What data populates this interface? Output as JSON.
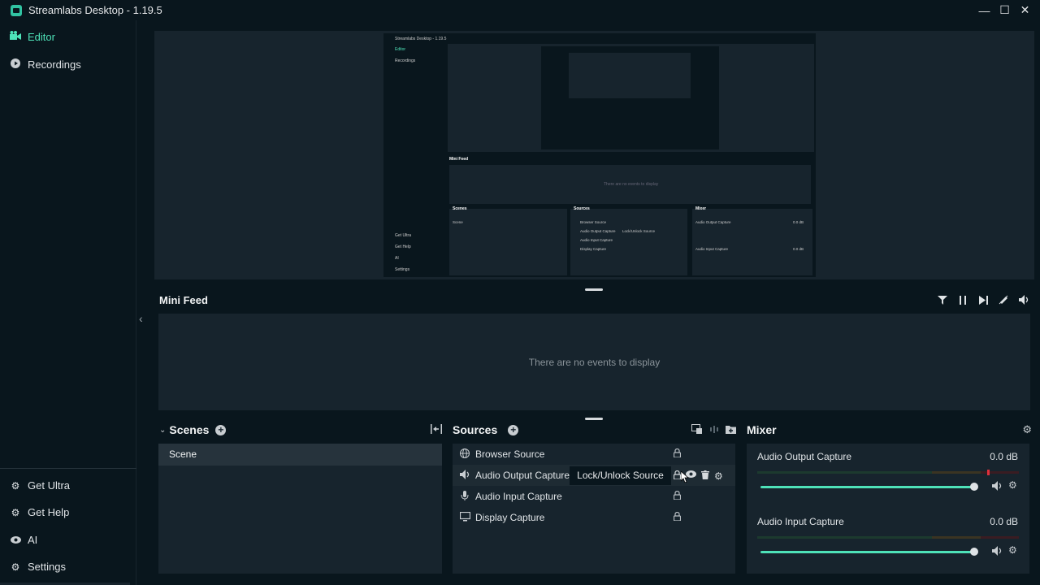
{
  "window": {
    "title": "Streamlabs Desktop - 1.19.5",
    "minimize": "—",
    "maximize": "☐",
    "close": "✕"
  },
  "nav": {
    "items": [
      {
        "label": "Editor",
        "icon": "editor-icon"
      },
      {
        "label": "Recordings",
        "icon": "recordings-icon"
      }
    ],
    "bottom": [
      {
        "label": "Get Ultra",
        "icon": "ultra-icon"
      },
      {
        "label": "Get Help",
        "icon": "help-icon"
      },
      {
        "label": "AI",
        "icon": "ai-eye-icon"
      },
      {
        "label": "Settings",
        "icon": "gear-icon"
      }
    ]
  },
  "nested": {
    "title": "Streamlabs Desktop - 1.19.5",
    "nav": [
      "Editor",
      "Recordings"
    ],
    "nav_bottom": [
      "Get Ultra",
      "Get Help",
      "AI",
      "Settings"
    ],
    "mini_feed": "Mini Feed",
    "empty": "There are no events to display",
    "scenes": "Scenes",
    "scene": "Scene",
    "sources": "Sources",
    "source_rows": [
      "Browser Source",
      "Audio Output Capture",
      "Audio Input Capture",
      "Display Capture"
    ],
    "tooltip": "Lock/Unlock Source",
    "mixer": "Mixer",
    "mix1": "Audio Output Capture",
    "mix2": "Audio Input Capture",
    "db": "0.0 dB"
  },
  "mini_feed": {
    "title": "Mini Feed",
    "empty_text": "There are no events to display"
  },
  "scenes": {
    "title": "Scenes",
    "items": [
      "Scene"
    ]
  },
  "sources": {
    "title": "Sources",
    "items": [
      {
        "label": "Browser Source",
        "icon": "globe-icon"
      },
      {
        "label": "Audio Output Capture",
        "icon": "speaker-icon"
      },
      {
        "label": "Audio Input Capture",
        "icon": "microphone-icon"
      },
      {
        "label": "Display Capture",
        "icon": "monitor-icon"
      }
    ],
    "tooltip": "Lock/Unlock Source"
  },
  "mixer": {
    "title": "Mixer",
    "channels": [
      {
        "name": "Audio Output Capture",
        "db": "0.0 dB",
        "volume": 1.0
      },
      {
        "name": "Audio Input Capture",
        "db": "0.0 dB",
        "volume": 1.0
      }
    ]
  },
  "colors": {
    "accent": "#4ee2b8",
    "bg": "#09161d",
    "panel": "#17242d",
    "row_selected": "#26333c"
  }
}
